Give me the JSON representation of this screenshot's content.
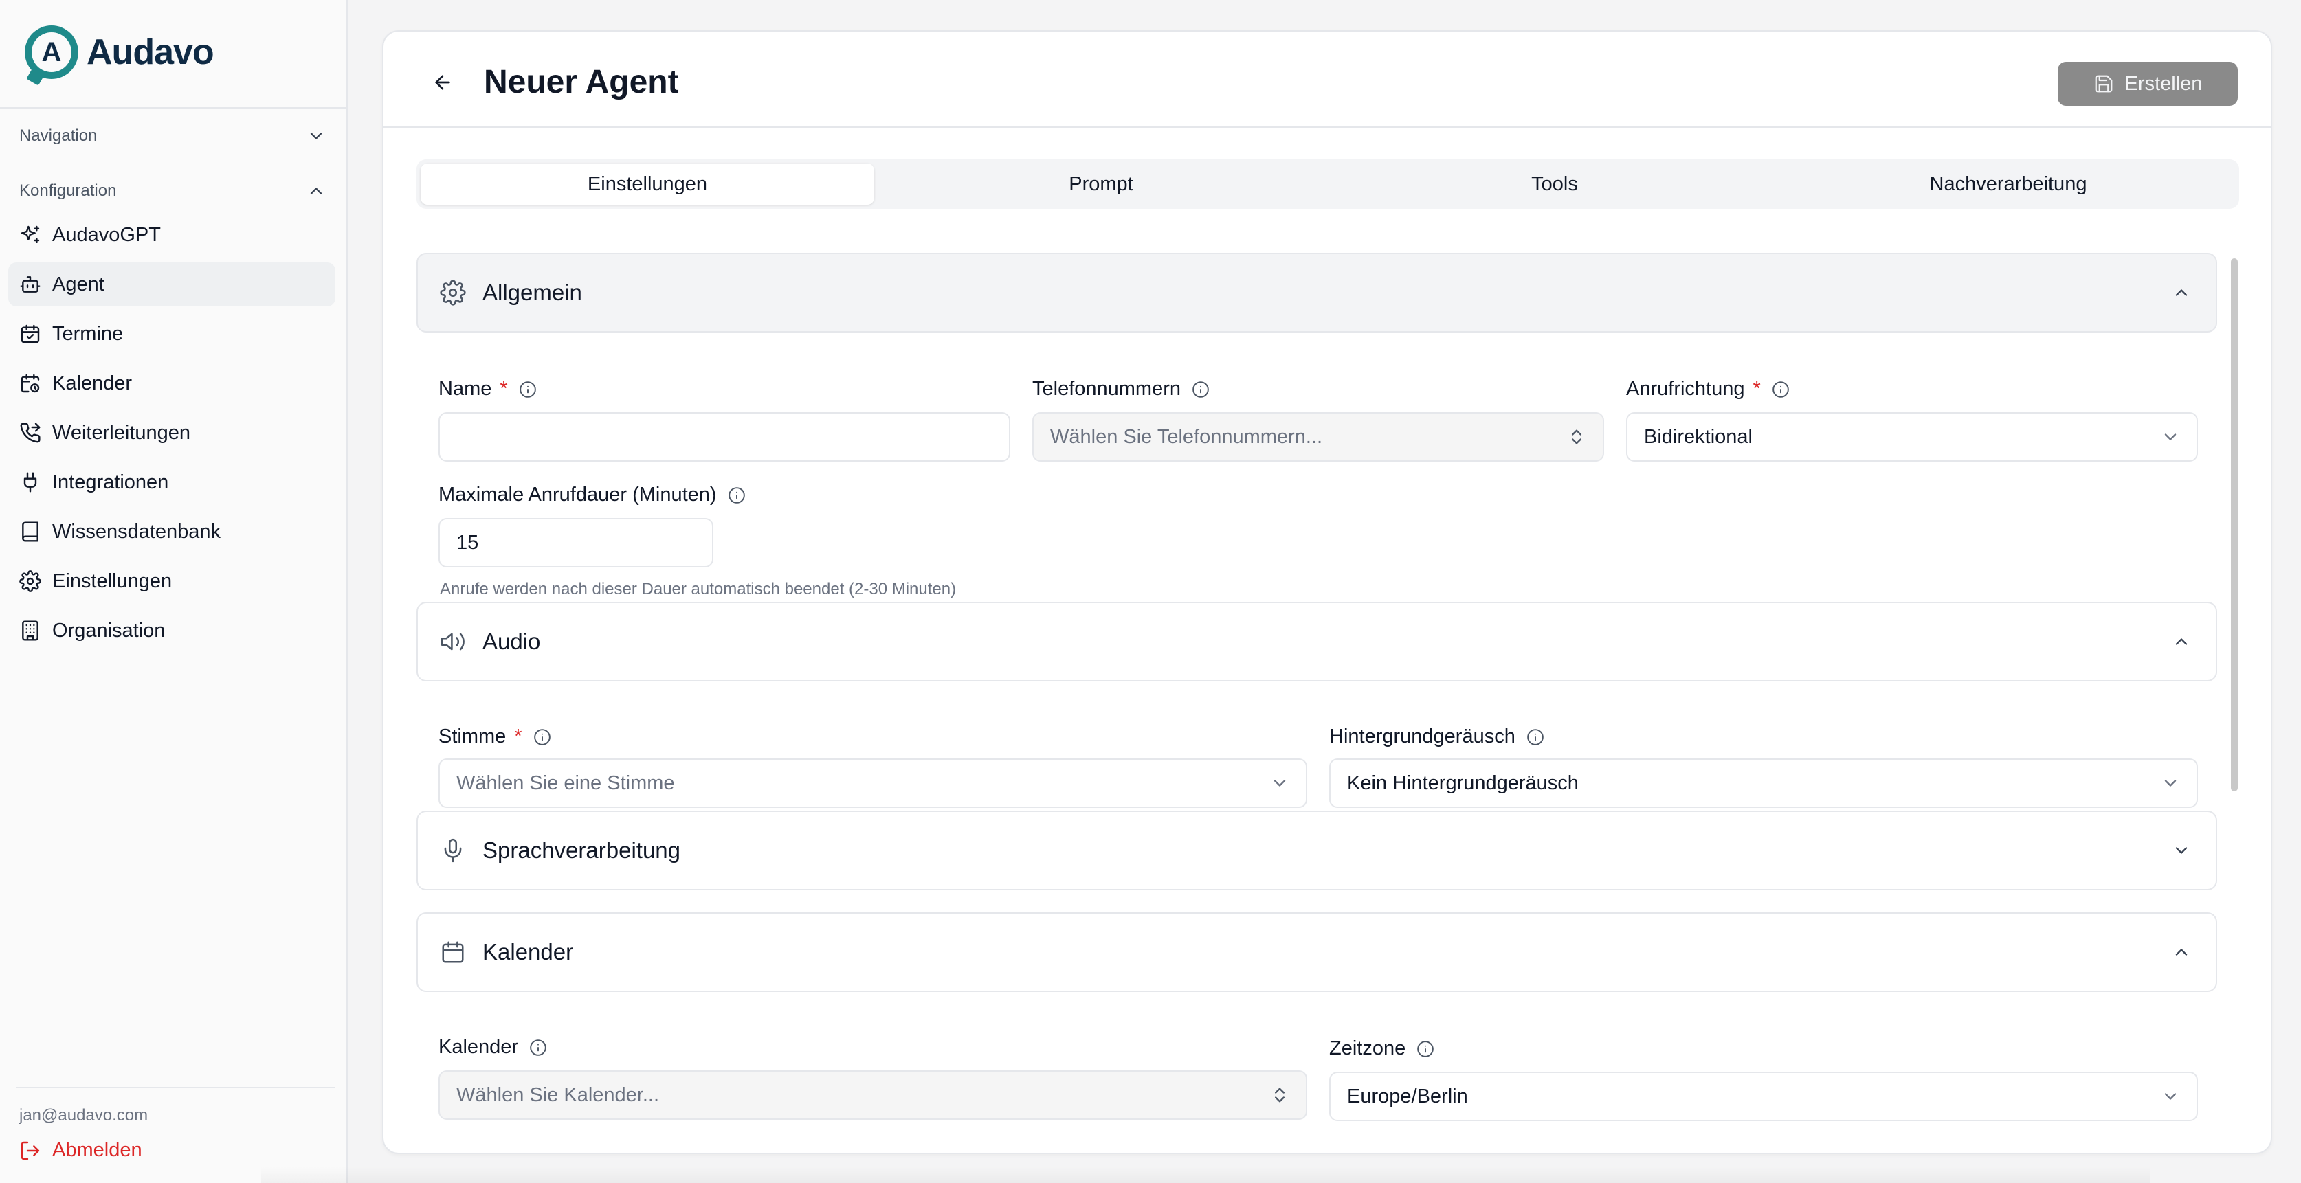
{
  "brand": {
    "name": "Audavo",
    "logo_letter": "A",
    "accent": "#1f8a8a"
  },
  "sidebar": {
    "groups": [
      {
        "label": "Navigation",
        "expanded": false
      },
      {
        "label": "Konfiguration",
        "expanded": true
      }
    ],
    "items": [
      {
        "label": "AudavoGPT",
        "icon": "sparkles-icon"
      },
      {
        "label": "Agent",
        "icon": "bot-icon",
        "active": true
      },
      {
        "label": "Termine",
        "icon": "calendar-check-icon"
      },
      {
        "label": "Kalender",
        "icon": "calendar-clock-icon"
      },
      {
        "label": "Weiterleitungen",
        "icon": "phone-forward-icon"
      },
      {
        "label": "Integrationen",
        "icon": "plug-icon"
      },
      {
        "label": "Wissensdatenbank",
        "icon": "book-icon"
      },
      {
        "label": "Einstellungen",
        "icon": "gear-icon"
      },
      {
        "label": "Organisation",
        "icon": "building-icon"
      }
    ],
    "user_email": "jan@audavo.com",
    "logout_label": "Abmelden"
  },
  "header": {
    "title": "Neuer Agent",
    "create_label": "Erstellen"
  },
  "tabs": [
    {
      "label": "Einstellungen",
      "active": true
    },
    {
      "label": "Prompt"
    },
    {
      "label": "Tools"
    },
    {
      "label": "Nachverarbeitung"
    }
  ],
  "sections": {
    "allgemein": {
      "title": "Allgemein",
      "name_label": "Name",
      "name_value": "",
      "phone_label": "Telefonnummern",
      "phone_placeholder": "Wählen Sie Telefonnummern...",
      "direction_label": "Anrufrichtung",
      "direction_value": "Bidirektional",
      "duration_label": "Maximale Anrufdauer (Minuten)",
      "duration_value": "15",
      "duration_hint": "Anrufe werden nach dieser Dauer automatisch beendet (2-30 Minuten)"
    },
    "audio": {
      "title": "Audio",
      "voice_label": "Stimme",
      "voice_placeholder": "Wählen Sie eine Stimme",
      "noise_label": "Hintergrundgeräusch",
      "noise_value": "Kein Hintergrundgeräusch"
    },
    "sprache": {
      "title": "Sprachverarbeitung"
    },
    "kalender": {
      "title": "Kalender",
      "calendar_label": "Kalender",
      "calendar_placeholder": "Wählen Sie Kalender...",
      "timezone_label": "Zeitzone",
      "timezone_value": "Europe/Berlin"
    }
  },
  "required_marker": "*"
}
